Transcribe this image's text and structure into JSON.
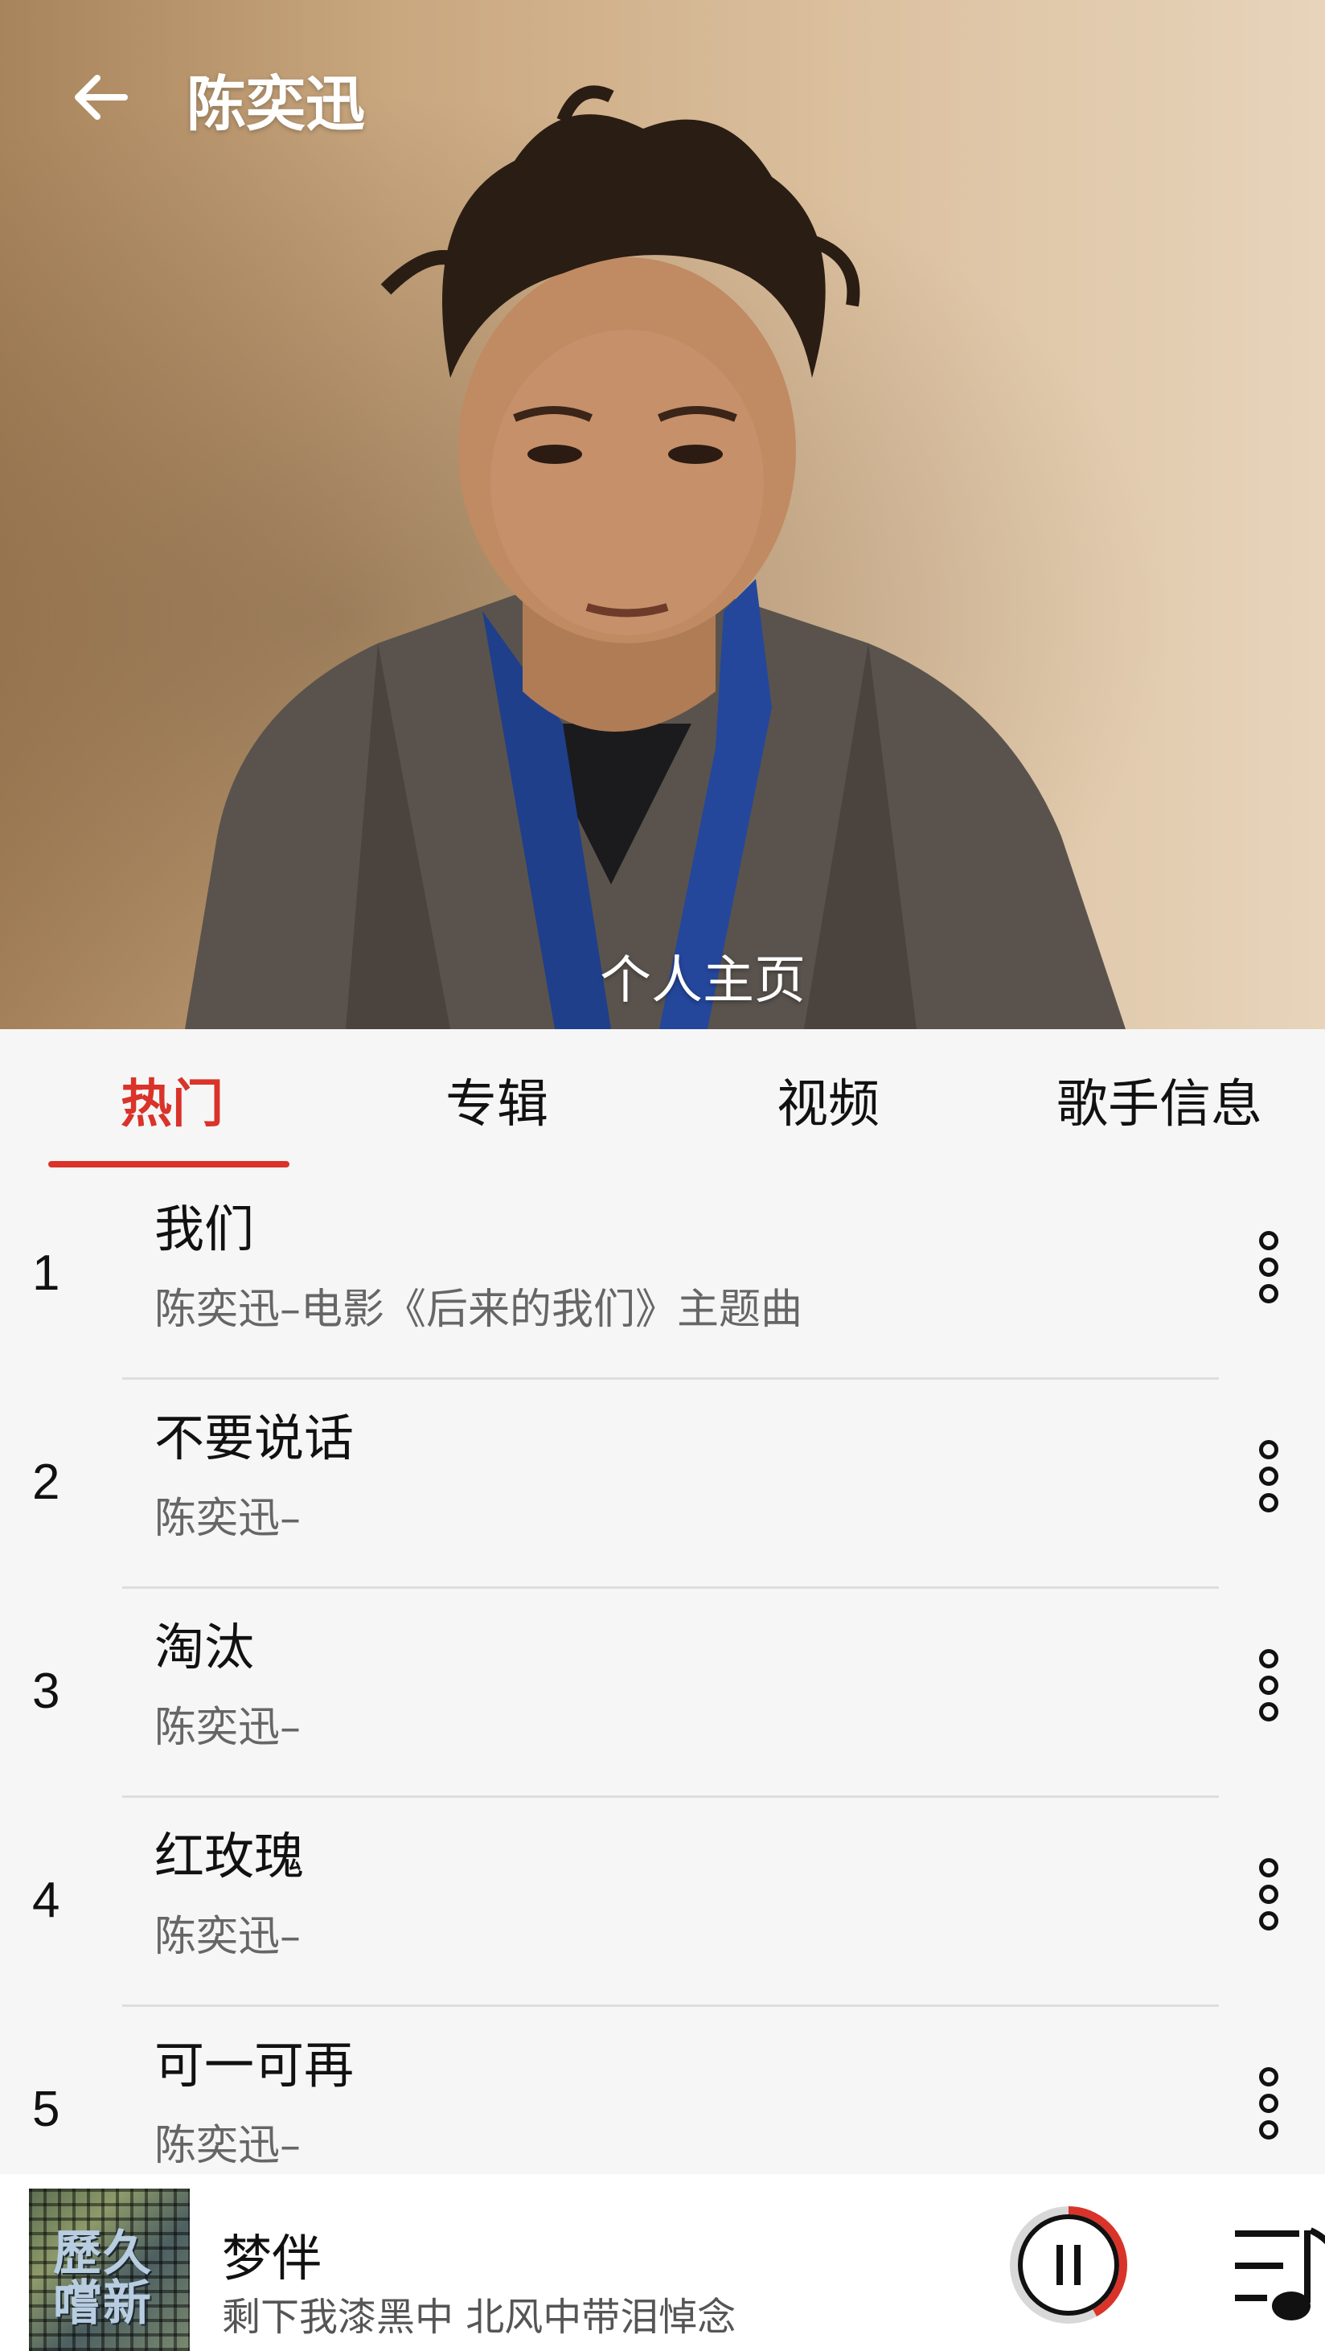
{
  "header": {
    "title": "陈奕迅",
    "back_icon": "arrow-left-icon"
  },
  "hero": {
    "profile_link": "个人主页"
  },
  "tabs": [
    {
      "label": "热门",
      "active": true
    },
    {
      "label": "专辑",
      "active": false
    },
    {
      "label": "视频",
      "active": false
    },
    {
      "label": "歌手信息",
      "active": false
    }
  ],
  "songs": [
    {
      "rank": "1",
      "title": "我们",
      "subtitle": "陈奕迅–电影《后来的我们》主题曲"
    },
    {
      "rank": "2",
      "title": "不要说话",
      "subtitle": "陈奕迅–"
    },
    {
      "rank": "3",
      "title": "淘汰",
      "subtitle": "陈奕迅–"
    },
    {
      "rank": "4",
      "title": "红玫瑰",
      "subtitle": "陈奕迅–"
    },
    {
      "rank": "5",
      "title": "可一可再",
      "subtitle": "陈奕迅–"
    }
  ],
  "player": {
    "title": "梦伴",
    "lyric": "剩下我漆黑中 北风中带泪悼念",
    "album_cover_text": "歷久嚐新",
    "progress": 0.42
  },
  "colors": {
    "accent": "#d9332a",
    "background": "#f6f6f6",
    "text_secondary": "#666666"
  }
}
